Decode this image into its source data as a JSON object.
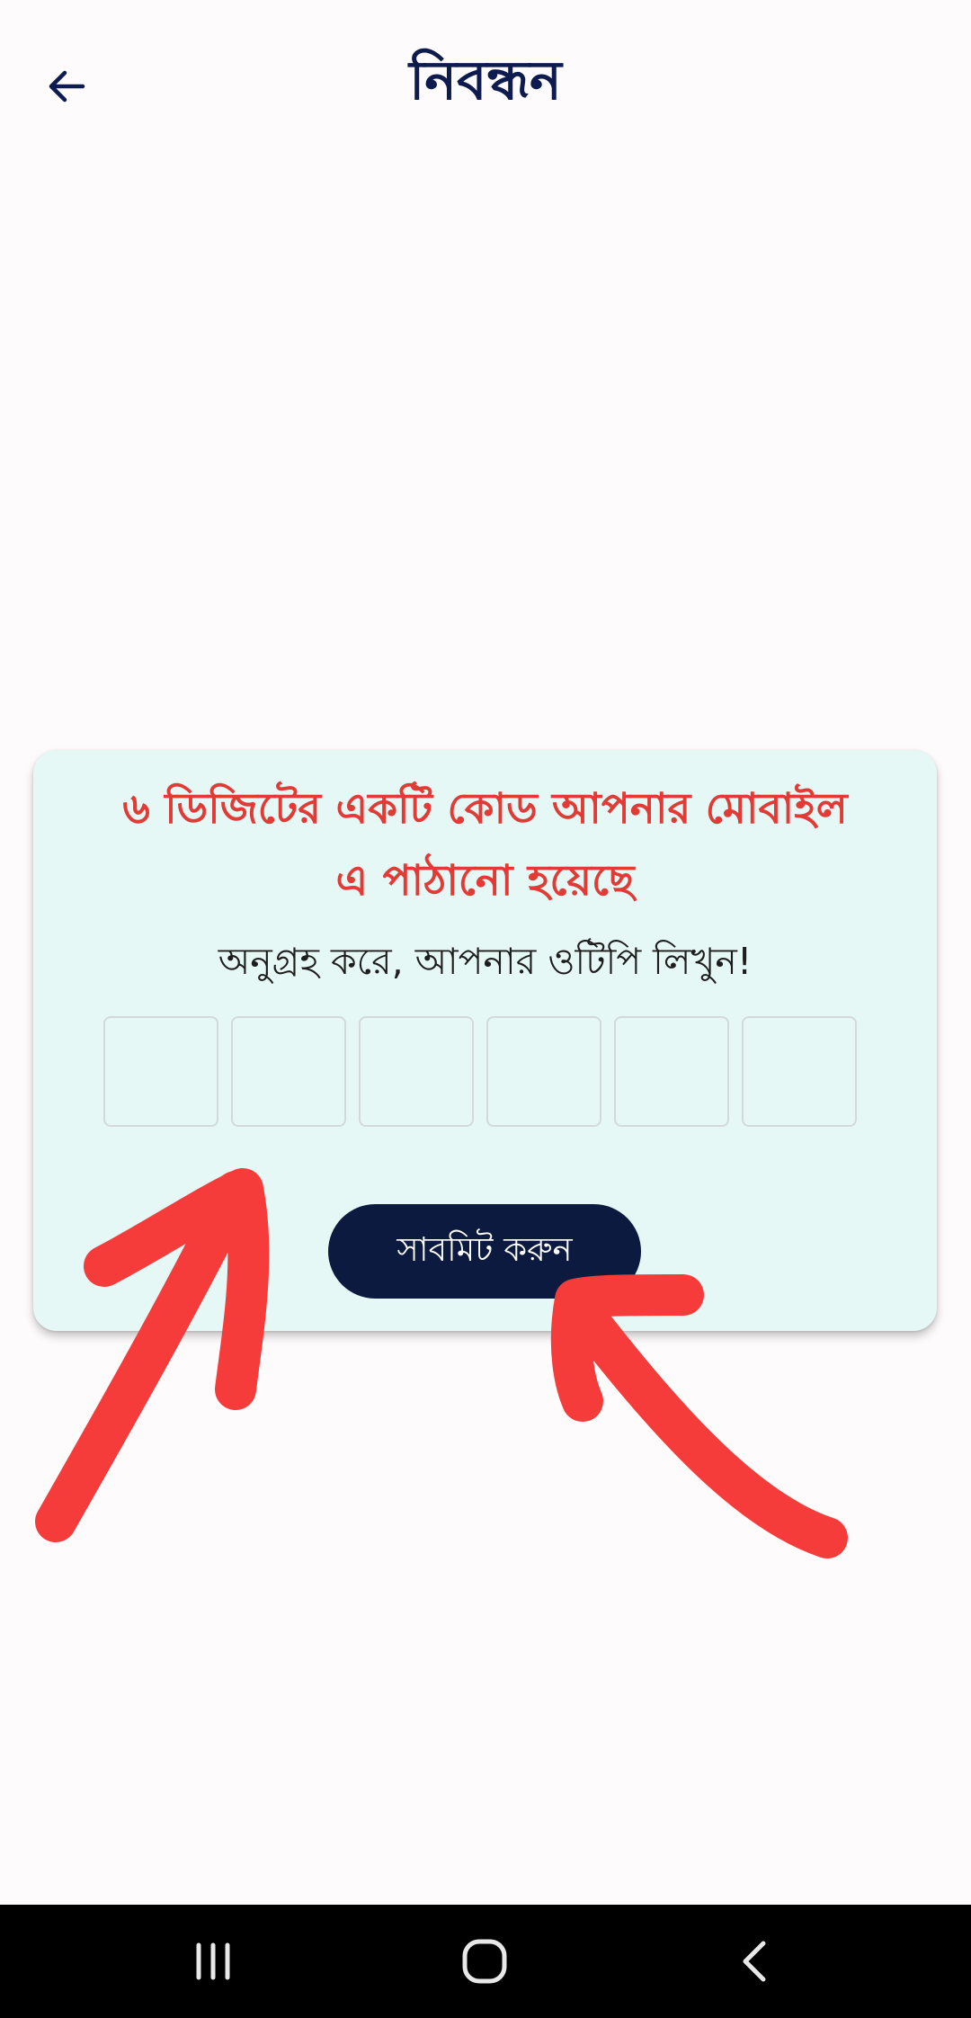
{
  "header": {
    "title": "নিবন্ধন",
    "back_icon": "arrow-left-icon"
  },
  "otp_card": {
    "heading_line1": "৬ ডিজিটের একটি কোড আপনার মোবাইল",
    "heading_line2": "এ পাঠানো হয়েছে",
    "instruction": "অনুগ্রহ করে, আপনার ওটিপি লিখুন!",
    "otp_digits": [
      "",
      "",
      "",
      "",
      "",
      ""
    ],
    "submit_label": "সাবমিট করুন"
  },
  "annotations": {
    "color": "#f63b3b",
    "arrows": [
      "pointing-to-otp-fields",
      "pointing-to-submit-button"
    ]
  },
  "system_nav": {
    "recents_icon": "recent-apps-icon",
    "home_icon": "home-icon",
    "back_icon": "back-chevron-icon"
  },
  "colors": {
    "title": "#0d1b4f",
    "heading": "#e23b36",
    "card_bg": "#e6f8f6",
    "button_bg": "#0c1a3f",
    "page_bg": "#fefbfc"
  }
}
